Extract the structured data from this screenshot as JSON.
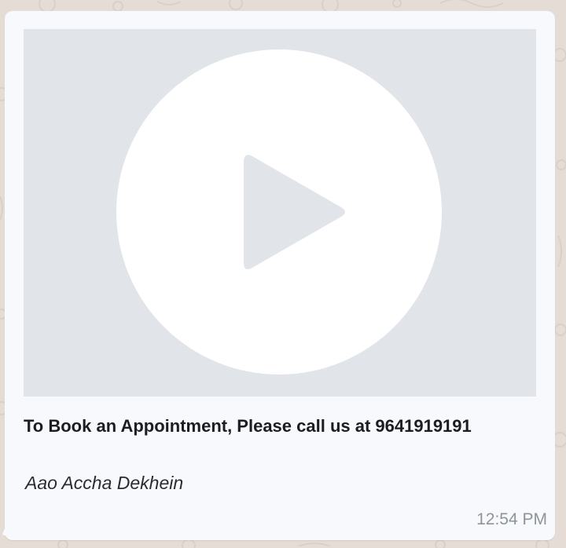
{
  "message": {
    "caption": "To Book an Appointment, Please call us at 9641919191",
    "tagline": "Aao Accha Dekhein",
    "time": "12:54 PM",
    "media": {
      "type": "video",
      "icon": "play-icon"
    }
  },
  "colors": {
    "chat_background": "#e5ddd5",
    "bubble_background": "#f7f9fc",
    "video_placeholder": "#e1e5ea",
    "play_circle": "#ffffff",
    "timestamp_text": "#8e9499"
  }
}
